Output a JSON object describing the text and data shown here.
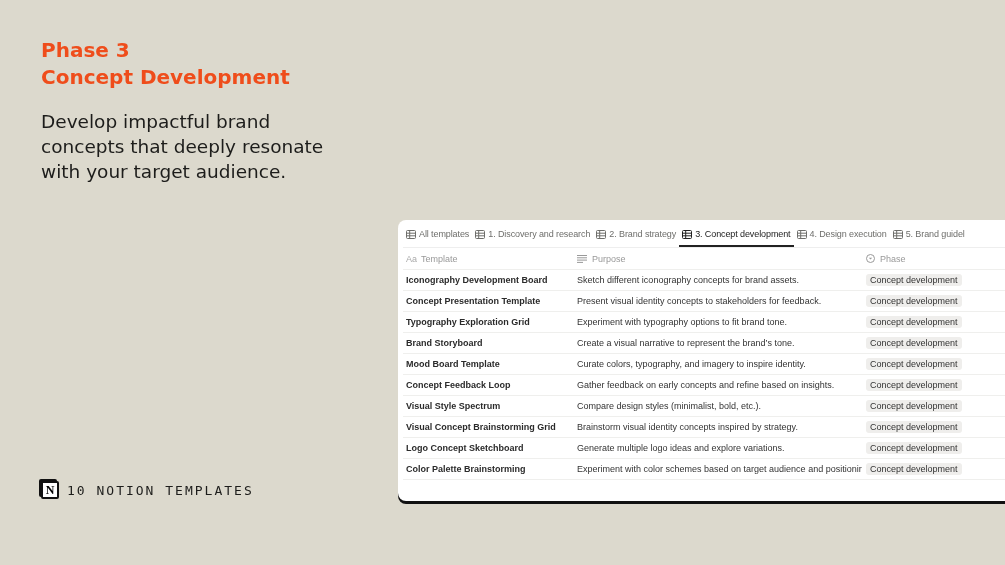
{
  "hero": {
    "phase": "Phase 3",
    "title": "Concept Development",
    "description": "Develop impactful brand concepts that deeply resonate with your target audience."
  },
  "footer": {
    "logo_letter": "N",
    "label": "10 NOTION TEMPLATES"
  },
  "tabs": [
    {
      "label": "All templates",
      "selected": false
    },
    {
      "label": "1. Discovery and research",
      "selected": false
    },
    {
      "label": "2. Brand strategy",
      "selected": false
    },
    {
      "label": "3. Concept development",
      "selected": true
    },
    {
      "label": "4. Design execution",
      "selected": false
    },
    {
      "label": "5. Brand guidel",
      "selected": false
    }
  ],
  "table": {
    "columns": [
      {
        "kind": "title",
        "label": "Template",
        "icon_text": "Aa"
      },
      {
        "kind": "text",
        "label": "Purpose"
      },
      {
        "kind": "select",
        "label": "Phase"
      }
    ],
    "rows": [
      [
        "Iconography Development Board",
        "Sketch different iconography concepts for brand assets.",
        "Concept development"
      ],
      [
        "Concept Presentation Template",
        "Present visual identity concepts to stakeholders for feedback.",
        "Concept development"
      ],
      [
        "Typography Exploration Grid",
        "Experiment with typography options to fit brand tone.",
        "Concept development"
      ],
      [
        "Brand Storyboard",
        "Create a visual narrative to represent the brand’s tone.",
        "Concept development"
      ],
      [
        "Mood Board Template",
        "Curate colors, typography, and imagery to inspire identity.",
        "Concept development"
      ],
      [
        "Concept Feedback Loop",
        "Gather feedback on early concepts and refine based on insights.",
        "Concept development"
      ],
      [
        "Visual Style Spectrum",
        "Compare design styles (minimalist, bold, etc.).",
        "Concept development"
      ],
      [
        "Visual Concept Brainstorming Grid",
        "Brainstorm visual identity concepts inspired by strategy.",
        "Concept development"
      ],
      [
        "Logo Concept Sketchboard",
        "Generate multiple logo ideas and explore variations.",
        "Concept development"
      ],
      [
        "Color Palette Brainstorming",
        "Experiment with color schemes based on target audience and positionir",
        "Concept development"
      ]
    ]
  }
}
